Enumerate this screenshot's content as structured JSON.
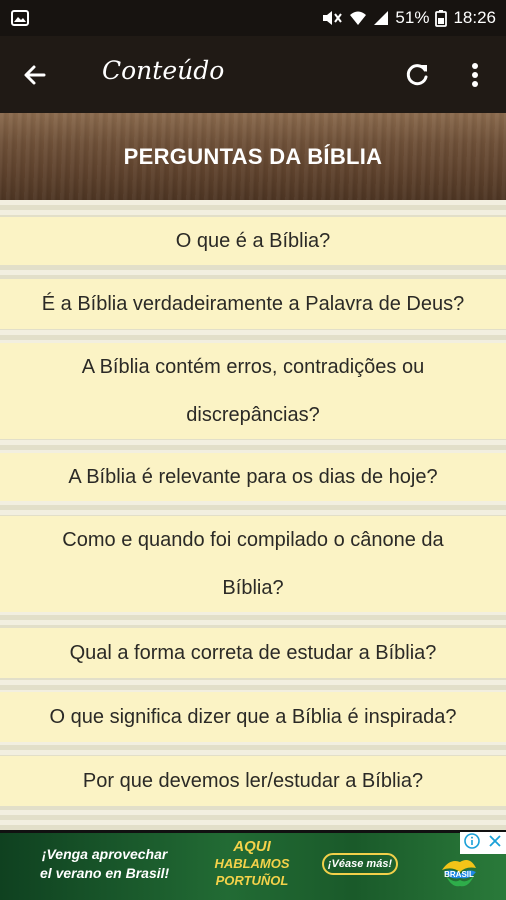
{
  "status_bar": {
    "battery_percent": "51%",
    "time": "18:26"
  },
  "app_bar": {
    "title": "Conteúdo"
  },
  "banner": {
    "title": "PERGUNTAS DA BÍBLIA"
  },
  "questions": [
    "O que é a Bíblia?",
    "É a Bíblia verdadeiramente a Palavra de Deus?",
    "A Bíblia contém erros, contradições ou discrepâncias?",
    "A Bíblia é relevante para os dias de hoje?",
    "Como e quando foi compilado o cânone da Bíblia?",
    "Qual a forma correta de estudar a Bíblia?",
    "O que significa dizer que a Bíblia é inspirada?",
    "Por que devemos ler/estudar a Bíblia?"
  ],
  "ad": {
    "slogan_line1": "¡Venga aprovechar",
    "slogan_line2": "el verano en Brasil!",
    "logo_line1": "AQUI",
    "logo_line2": "HABLAMOS",
    "logo_line3": "PORTUÑOL",
    "cta": "¡Véase más!",
    "brand": "BRASIL"
  },
  "colors": {
    "status_bar": "#171310",
    "app_bar": "#201a15",
    "item_background": "#fbf3c5",
    "item_text": "#2b2a26"
  }
}
